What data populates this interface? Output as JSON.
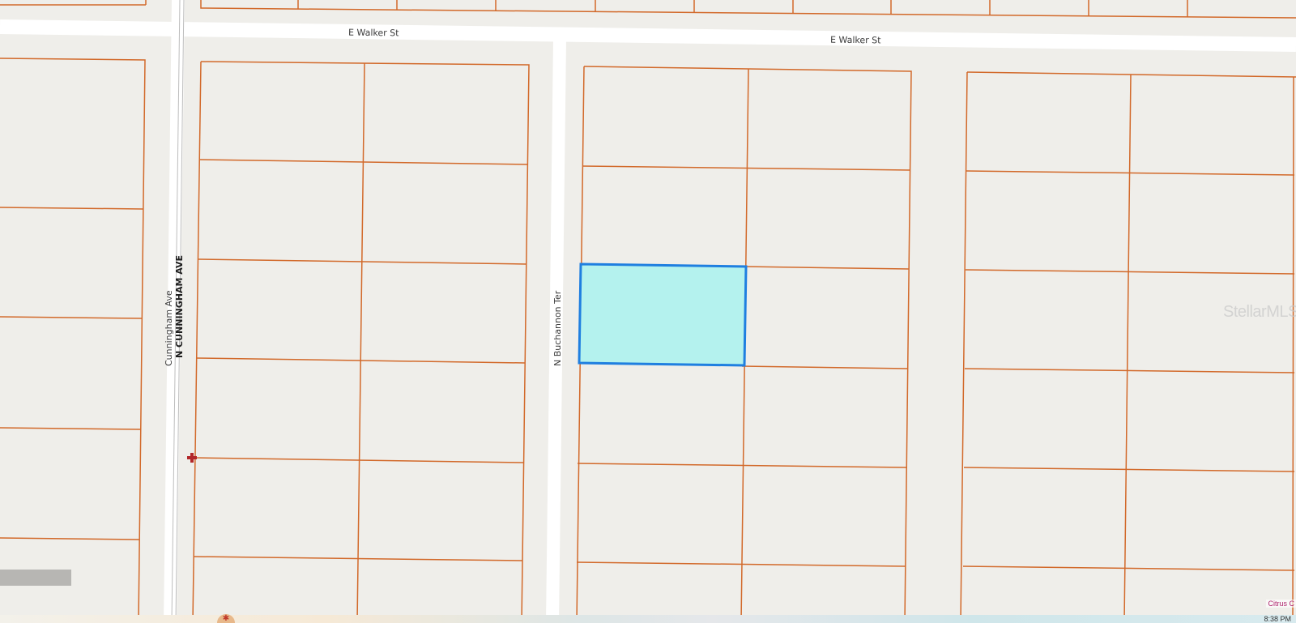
{
  "map": {
    "streets": {
      "walker_west": "E Walker St",
      "walker_east": "E Walker St",
      "cunningham_ave": "Cunningham Ave",
      "n_cunningham_ave": "N CUNNINGHAM AVE",
      "buchannon_ter": "N Buchannon Ter"
    },
    "colors": {
      "background": "#efeeea",
      "road": "#ffffff",
      "parcel_line": "#d2692a",
      "selected_fill": "#b4f2ee",
      "selected_stroke": "#1f7fe0",
      "marker": "#b2272a"
    },
    "selected_parcel": "highlighted lot",
    "marker_icon": "red-cross-marker-icon"
  },
  "overlay": {
    "watermark": "StellarMLS",
    "attribution": "Citrus C",
    "clock": "8:38 PM"
  }
}
